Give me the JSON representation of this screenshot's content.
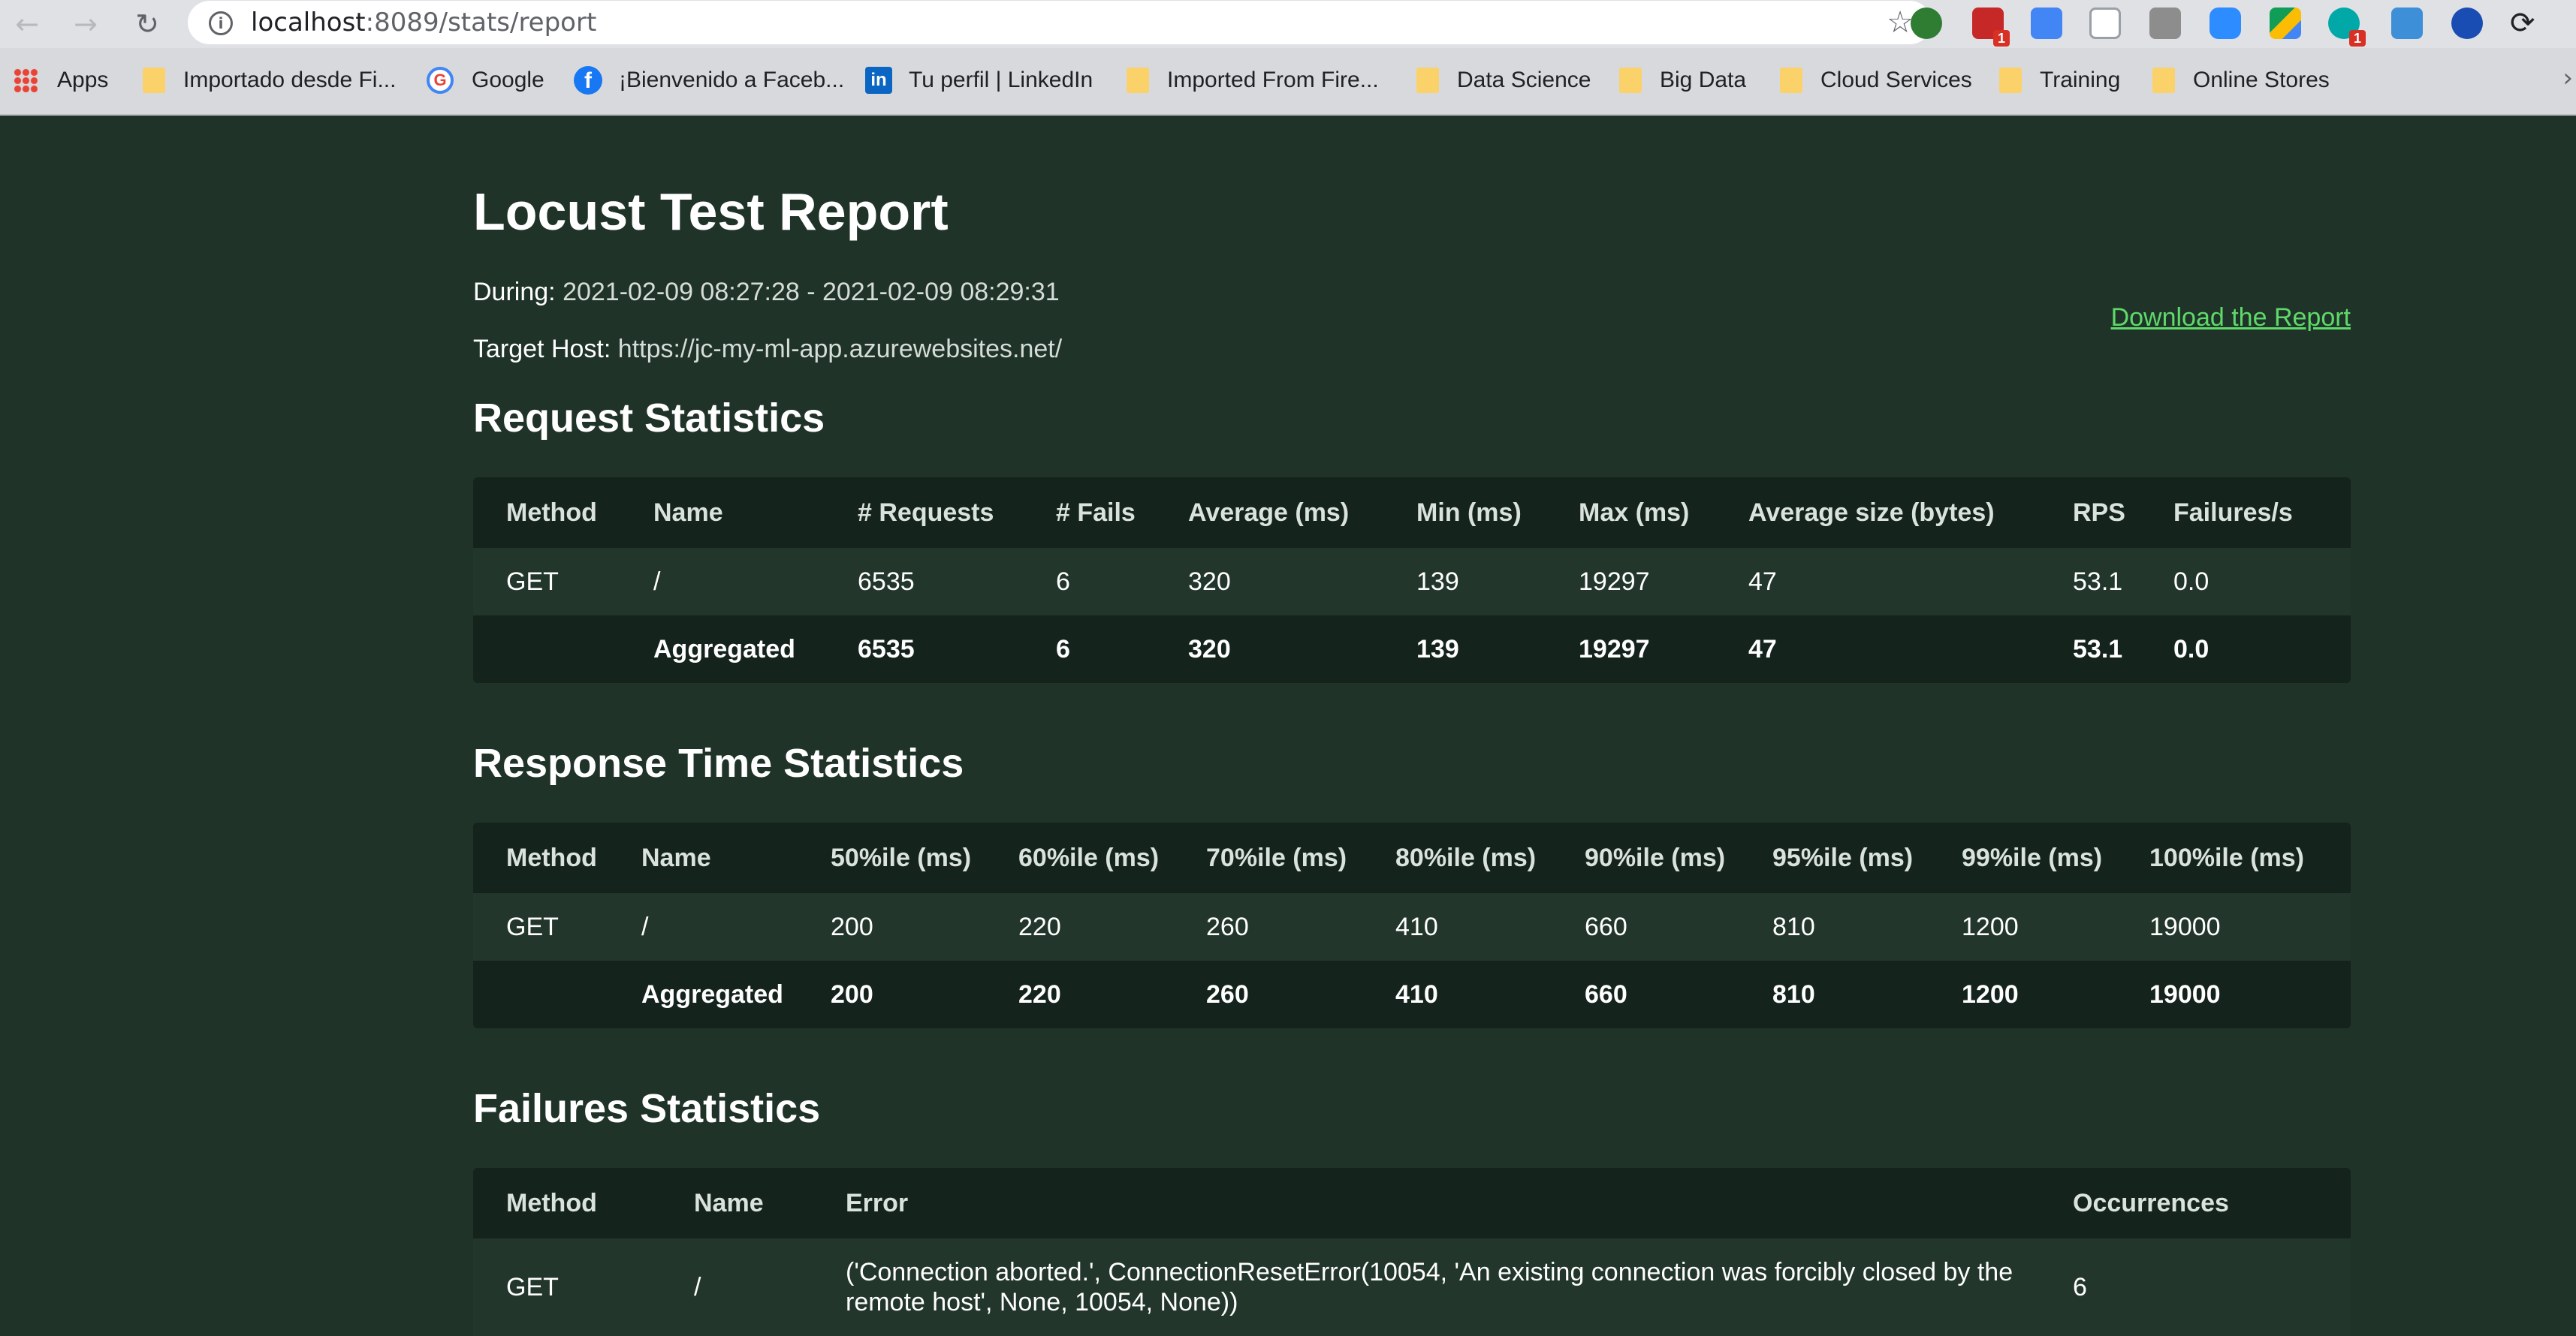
{
  "browser": {
    "url_host": "localhost",
    "url_path": ":8089/stats/report",
    "bookmarks": [
      {
        "label": "Apps",
        "icon": "apps-grid-icon"
      },
      {
        "label": "Importado desde Fi...",
        "icon": "folder-icon"
      },
      {
        "label": "Google",
        "icon": "google-icon"
      },
      {
        "label": "¡Bienvenido a Faceb...",
        "icon": "facebook-icon"
      },
      {
        "label": "Tu perfil | LinkedIn",
        "icon": "linkedin-icon"
      },
      {
        "label": "Imported From Fire...",
        "icon": "folder-icon"
      },
      {
        "label": "Data Science",
        "icon": "folder-icon"
      },
      {
        "label": "Big Data",
        "icon": "folder-icon"
      },
      {
        "label": "Cloud Services",
        "icon": "folder-icon"
      },
      {
        "label": "Training",
        "icon": "folder-icon"
      },
      {
        "label": "Online Stores",
        "icon": "folder-icon"
      }
    ],
    "extension_badges": {
      "calendar": "1",
      "a": "1"
    }
  },
  "report": {
    "title": "Locust Test Report",
    "during_label": "During:",
    "during_value": "2021-02-09 08:27:28 - 2021-02-09 08:29:31",
    "host_label": "Target Host:",
    "host_value": "https://jc-my-ml-app.azurewebsites.net/",
    "download_label": "Download the Report"
  },
  "request_stats": {
    "title": "Request Statistics",
    "headers": [
      "Method",
      "Name",
      "# Requests",
      "# Fails",
      "Average (ms)",
      "Min (ms)",
      "Max (ms)",
      "Average size (bytes)",
      "RPS",
      "Failures/s"
    ],
    "rows": [
      [
        "GET",
        "/",
        "6535",
        "6",
        "320",
        "139",
        "19297",
        "47",
        "53.1",
        "0.0"
      ]
    ],
    "aggregated": [
      "",
      "Aggregated",
      "6535",
      "6",
      "320",
      "139",
      "19297",
      "47",
      "53.1",
      "0.0"
    ]
  },
  "response_stats": {
    "title": "Response Time Statistics",
    "headers": [
      "Method",
      "Name",
      "50%ile (ms)",
      "60%ile (ms)",
      "70%ile (ms)",
      "80%ile (ms)",
      "90%ile (ms)",
      "95%ile (ms)",
      "99%ile (ms)",
      "100%ile (ms)"
    ],
    "rows": [
      [
        "GET",
        "/",
        "200",
        "220",
        "260",
        "410",
        "660",
        "810",
        "1200",
        "19000"
      ]
    ],
    "aggregated": [
      "",
      "Aggregated",
      "200",
      "220",
      "260",
      "410",
      "660",
      "810",
      "1200",
      "19000"
    ]
  },
  "failure_stats": {
    "title": "Failures Statistics",
    "headers": [
      "Method",
      "Name",
      "Error",
      "Occurrences"
    ],
    "rows": [
      [
        "GET",
        "/",
        "('Connection aborted.', ConnectionResetError(10054, 'An existing connection was forcibly closed by the remote host', None, 10054, None))",
        "6"
      ]
    ]
  },
  "colors": {
    "page_bg": "#1f3329",
    "table_bg": "#14231b",
    "row_bg": "#22362b",
    "link": "#5fd96a"
  }
}
